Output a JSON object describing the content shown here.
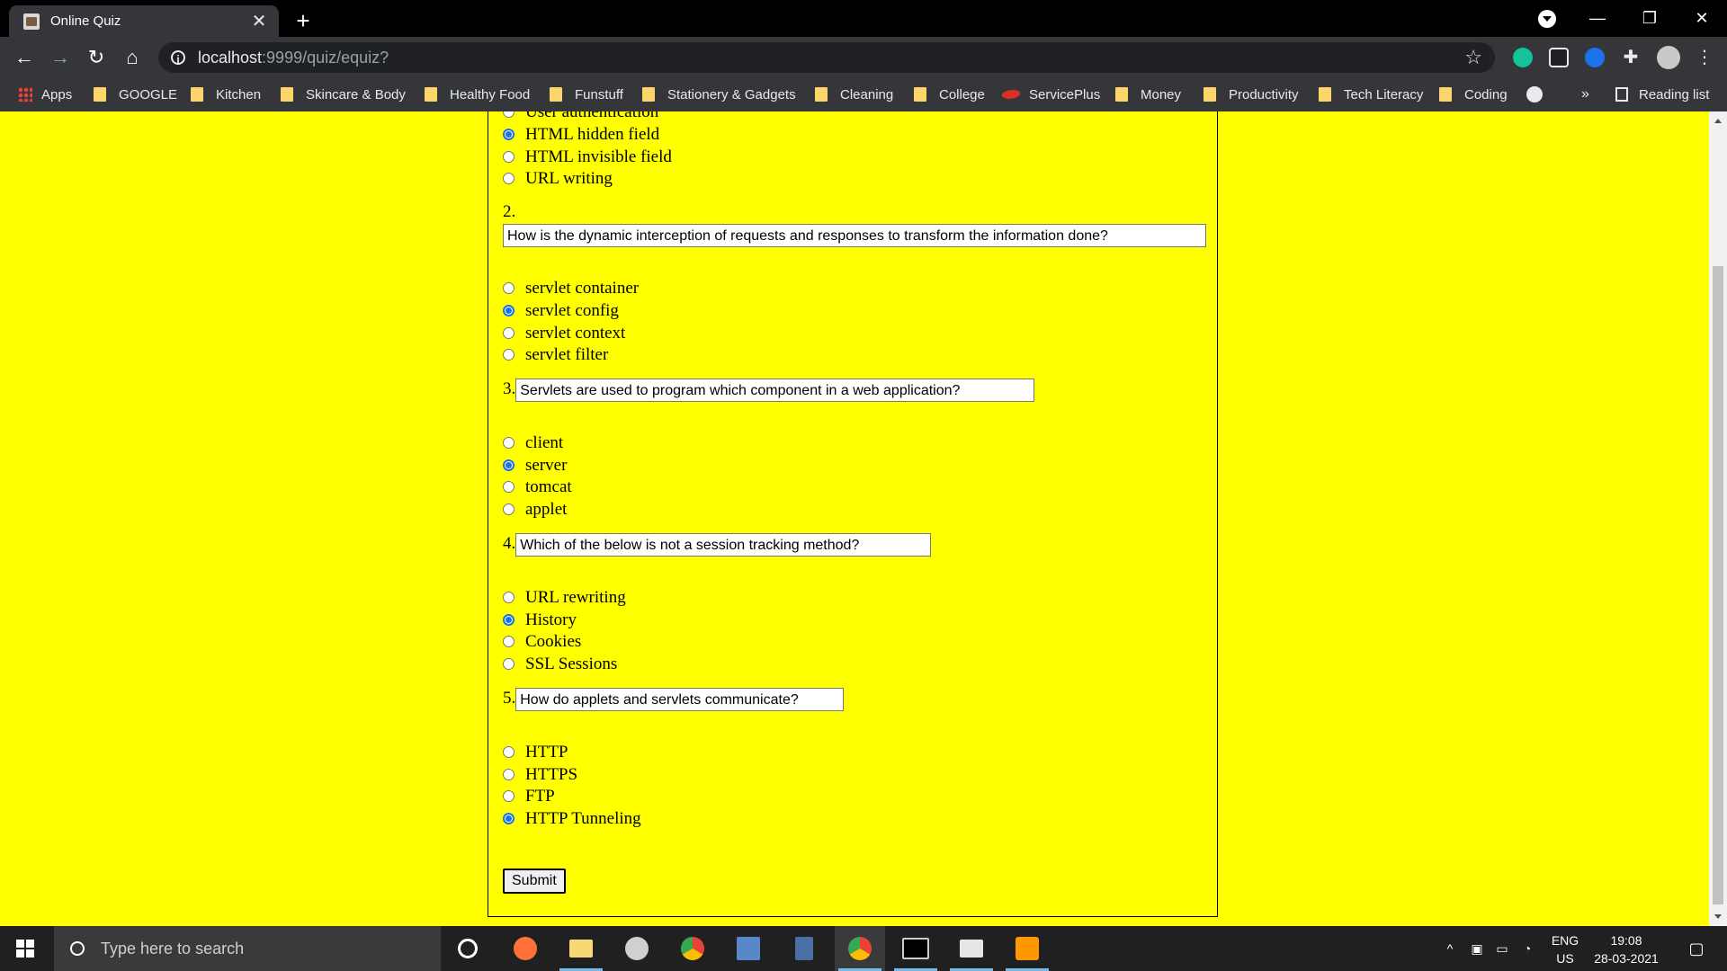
{
  "browser": {
    "tab_title": "Online Quiz",
    "tab_close": "✕",
    "new_tab": "+",
    "url_host": "localhost",
    "url_path": ":9999/quiz/equiz?",
    "window_controls": {
      "minimize": "—",
      "restore": "❐",
      "close": "✕"
    }
  },
  "bookmarks": {
    "apps": "Apps",
    "items": [
      "GOOGLE",
      "Kitchen",
      "Skincare & Body",
      "Healthy Food",
      "Funstuff",
      "Stationery & Gadgets",
      "Cleaning",
      "College",
      "ServicePlus",
      "Money",
      "Productivity",
      "Tech Literacy",
      "Coding"
    ],
    "overflow": "»",
    "reading_list": "Reading list"
  },
  "quiz": {
    "q1_options": [
      {
        "label": "User authentication",
        "selected": false
      },
      {
        "label": "HTML hidden field",
        "selected": true
      },
      {
        "label": "HTML invisible field",
        "selected": false
      },
      {
        "label": "URL writing",
        "selected": false
      }
    ],
    "questions": [
      {
        "number": "2.",
        "text": "How is the dynamic interception of requests and responses to transform the information done?",
        "options": [
          {
            "label": "servlet container",
            "selected": false
          },
          {
            "label": "servlet config",
            "selected": true
          },
          {
            "label": "servlet context",
            "selected": false
          },
          {
            "label": "servlet filter",
            "selected": false
          }
        ]
      },
      {
        "number": "3.",
        "text": "Servlets are used to program which component in a web application?",
        "options": [
          {
            "label": "client",
            "selected": false
          },
          {
            "label": "server",
            "selected": true
          },
          {
            "label": "tomcat",
            "selected": false
          },
          {
            "label": "applet",
            "selected": false
          }
        ]
      },
      {
        "number": "4.",
        "text": "Which of the below is not a session tracking method?",
        "options": [
          {
            "label": "URL rewriting",
            "selected": false
          },
          {
            "label": "History",
            "selected": true
          },
          {
            "label": "Cookies",
            "selected": false
          },
          {
            "label": "SSL Sessions",
            "selected": false
          }
        ]
      },
      {
        "number": "5.",
        "text": "How do applets and servlets communicate?",
        "options": [
          {
            "label": "HTTP",
            "selected": false
          },
          {
            "label": "HTTPS",
            "selected": false
          },
          {
            "label": "FTP",
            "selected": false
          },
          {
            "label": "HTTP Tunneling",
            "selected": true
          }
        ]
      }
    ],
    "submit_label": "Submit"
  },
  "taskbar": {
    "search_placeholder": "Type here to search",
    "language": "ENG",
    "region": "US",
    "time": "19:08",
    "date": "28-03-2021"
  },
  "colors": {
    "page_background": "#ffff00",
    "radio_selected": "#1a73e8"
  }
}
